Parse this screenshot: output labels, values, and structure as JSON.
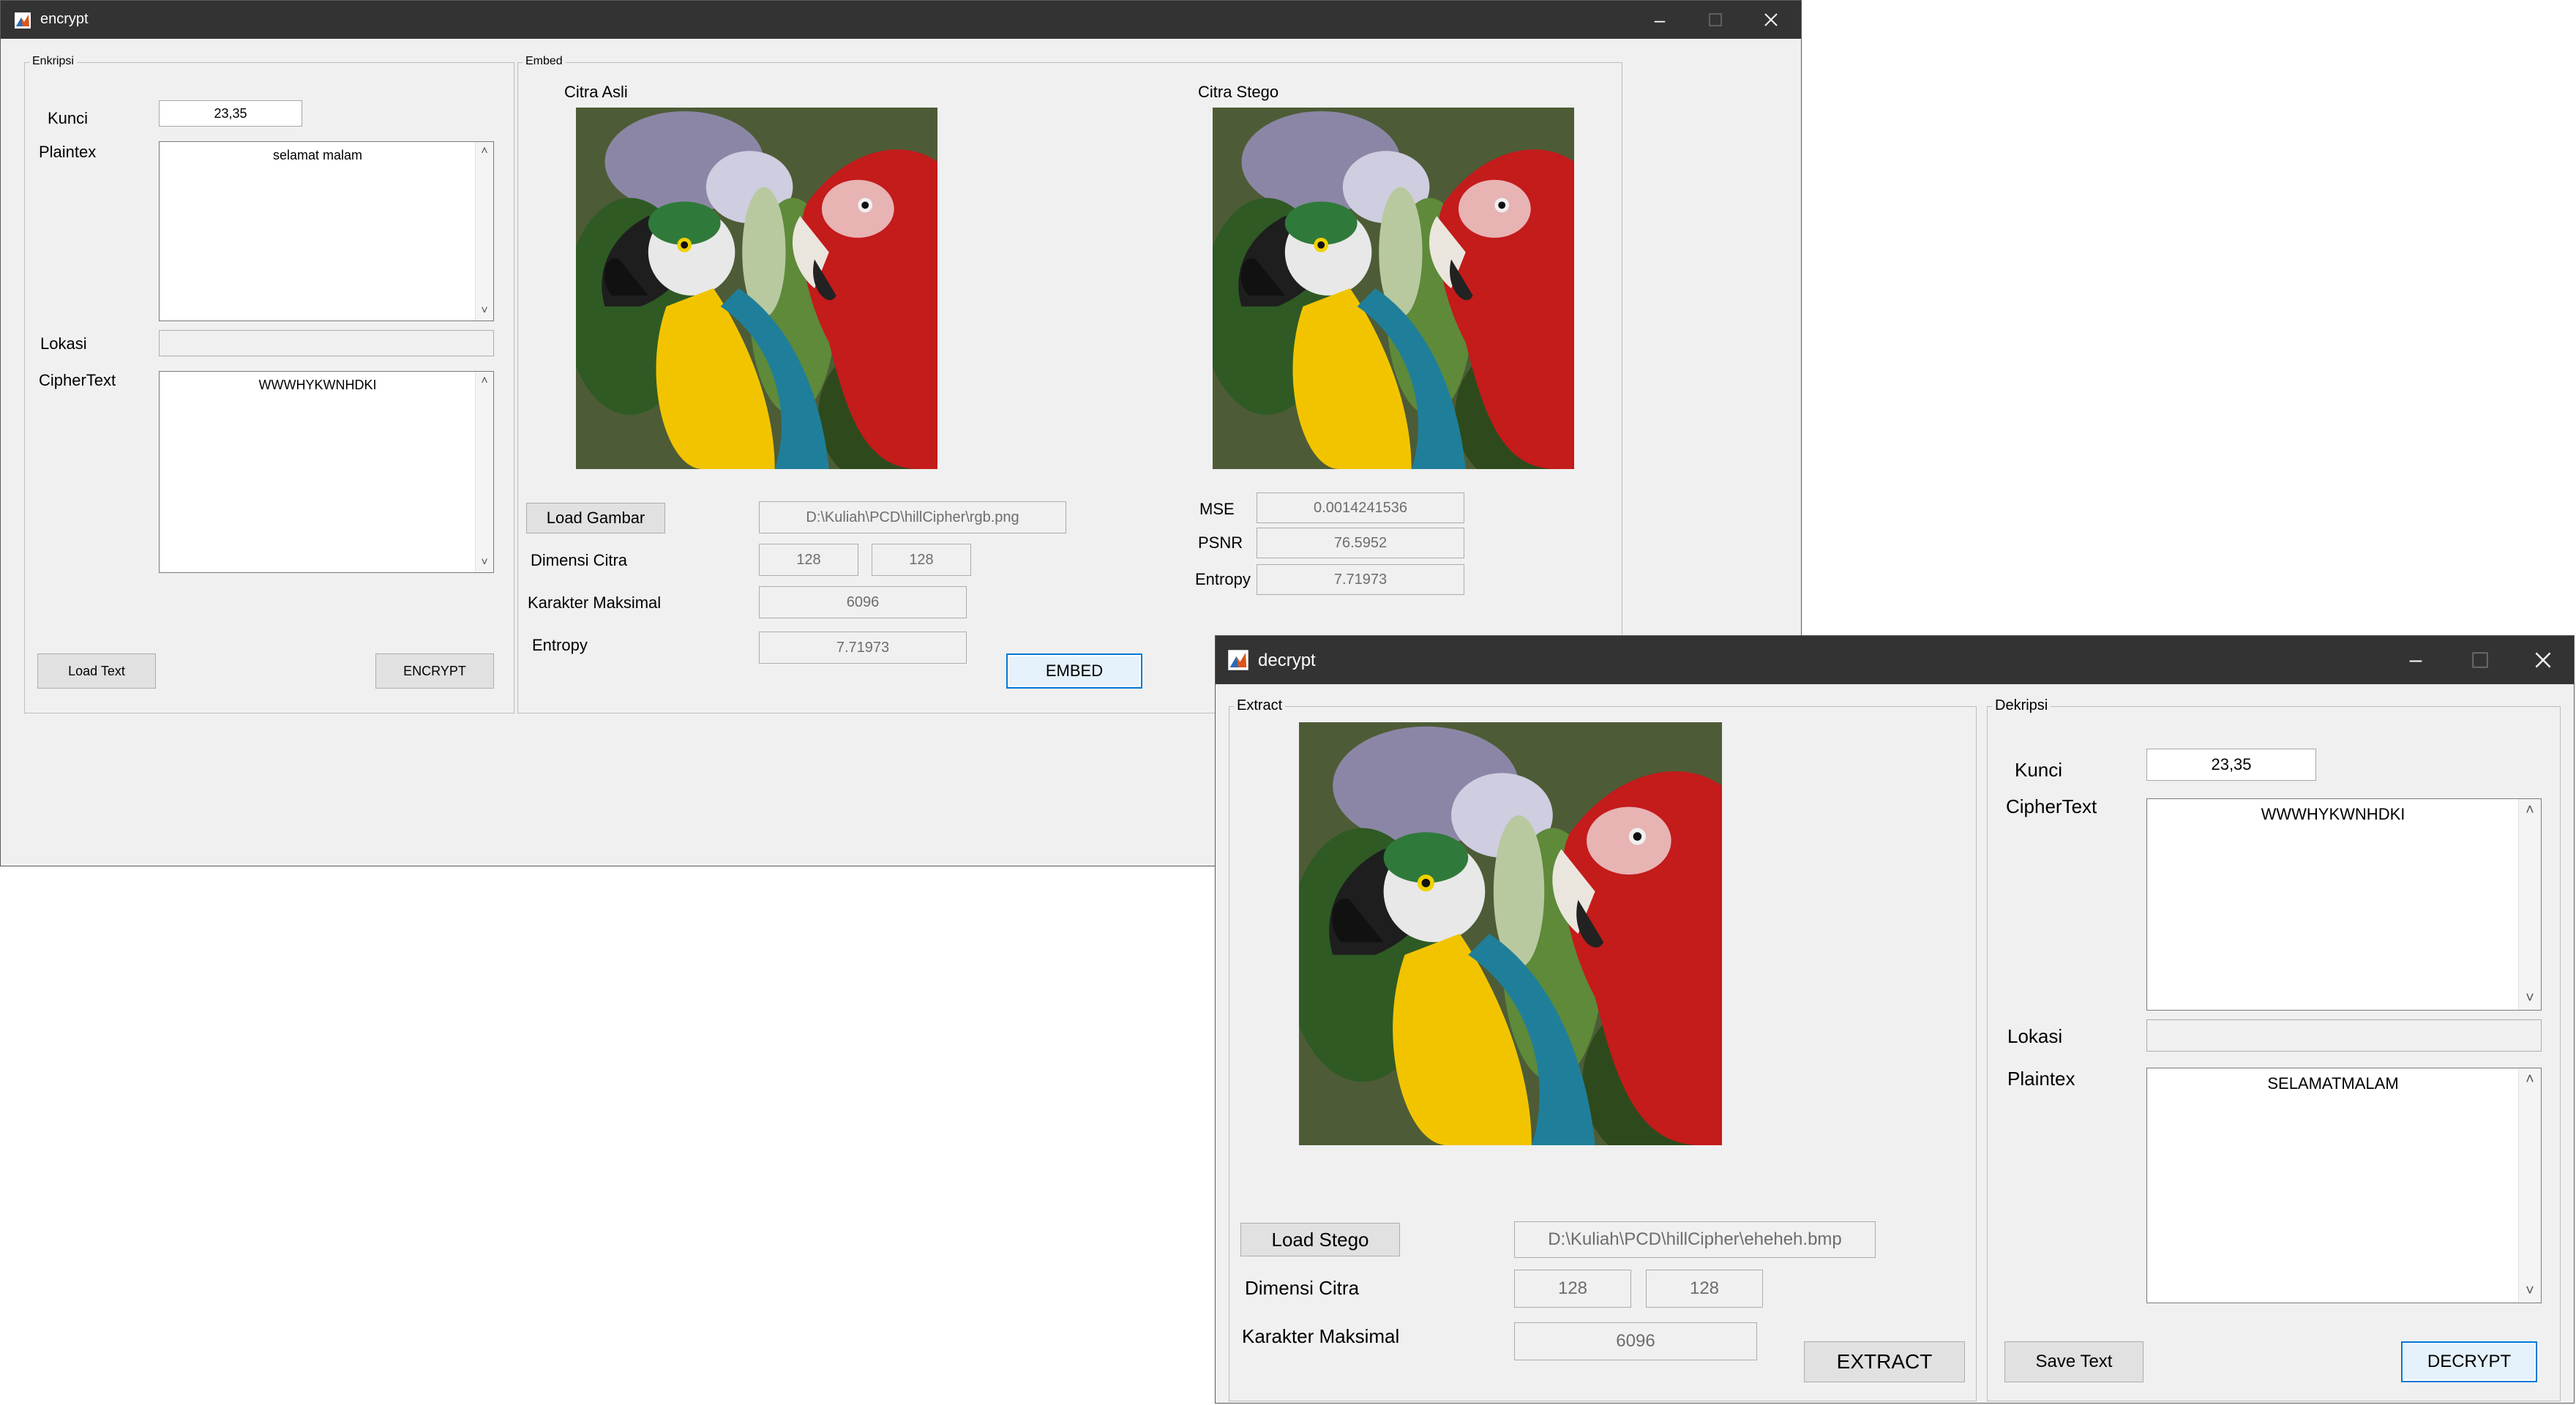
{
  "colors": {
    "titlebar": "#333333",
    "window_bg": "#f0f0f0",
    "accent": "#0078d7"
  },
  "icons": {
    "app": "matlab-figure-icon",
    "minimize": "minimize-icon",
    "maximize": "maximize-icon",
    "close": "close-icon"
  },
  "encrypt": {
    "title": "encrypt",
    "enkripsi": {
      "title": "Enkripsi",
      "kunci_label": "Kunci",
      "kunci_value": "23,35",
      "plaintext_label": "Plaintex",
      "plaintext_value": "selamat malam",
      "lokasi_label": "Lokasi",
      "lokasi_value": "",
      "ciphertext_label": "CipherText",
      "ciphertext_value": "WWWHYKWNHDKI",
      "load_text_button": "Load Text",
      "encrypt_button": "ENCRYPT"
    },
    "embed": {
      "title": "Embed",
      "citra_asli_label": "Citra Asli",
      "citra_stego_label": "Citra Stego",
      "load_gambar_button": "Load Gambar",
      "path_value": "D:\\Kuliah\\PCD\\hillCipher\\rgb.png",
      "dimensi_label": "Dimensi Citra",
      "dim_w": "128",
      "dim_h": "128",
      "karakter_label": "Karakter Maksimal",
      "karakter_value": "6096",
      "entropy_label": "Entropy",
      "entropy_value": "7.71973",
      "embed_button": "EMBED",
      "mse_label": "MSE",
      "mse_value": "0.0014241536",
      "psnr_label": "PSNR",
      "psnr_value": "76.5952",
      "stego_entropy_label": "Entropy",
      "stego_entropy_value": "7.71973"
    }
  },
  "decrypt": {
    "title": "decrypt",
    "extract": {
      "title": "Extract",
      "load_stego_button": "Load Stego",
      "path_value": "D:\\Kuliah\\PCD\\hillCipher\\eheheh.bmp",
      "dimensi_label": "Dimensi Citra",
      "dim_w": "128",
      "dim_h": "128",
      "karakter_label": "Karakter Maksimal",
      "karakter_value": "6096",
      "extract_button": "EXTRACT"
    },
    "dekripsi": {
      "title": "Dekripsi",
      "kunci_label": "Kunci",
      "kunci_value": "23,35",
      "ciphertext_label": "CipherText",
      "ciphertext_value": "WWWHYKWNHDKI",
      "lokasi_label": "Lokasi",
      "lokasi_value": "",
      "plaintext_label": "Plaintex",
      "plaintext_value": "SELAMATMALAM",
      "save_text_button": "Save Text",
      "decrypt_button": "DECRYPT"
    }
  }
}
